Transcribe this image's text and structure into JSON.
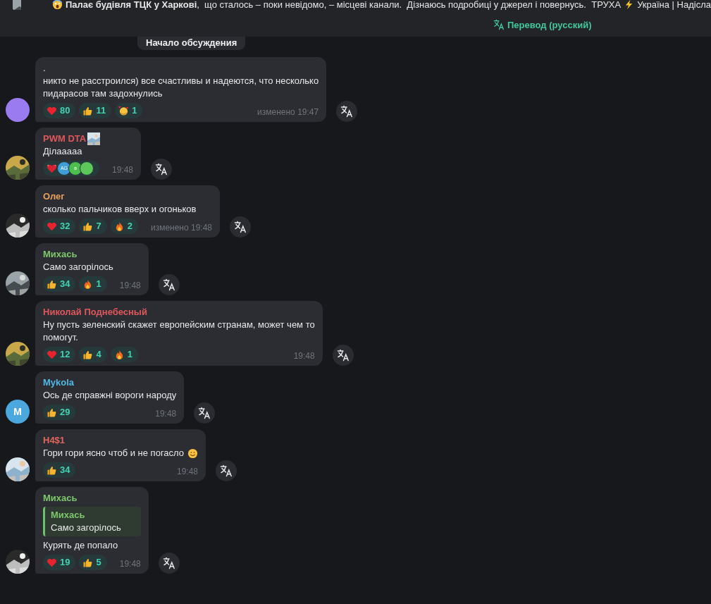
{
  "pinned": {
    "before": "**Палає будівля ТЦК у Харкові**,  що сталось – поки невідомо, – місцеві канали.  Дізнаюсь подробиці у джерел і повернусь.  ТРУХА",
    "after": "Україна | Надісла"
  },
  "translate_link": "Перевод (русский)",
  "discussion_start": "Начало обсуждения",
  "messages": [
    {
      "avatar": {
        "kind": "plain",
        "color": "#9b7cf0"
      },
      "lines": [
        ".",
        "никто не расстроился) все счастливы и надеются, что несколько",
        "пидарасов там задохнулись"
      ],
      "reactions": [
        {
          "kind": "heart",
          "count": "80"
        },
        {
          "kind": "thumbs",
          "count": "11"
        },
        {
          "kind": "hearts-face",
          "count": "1"
        }
      ],
      "time": "изменено 19:47"
    },
    {
      "avatar": {
        "kind": "picture"
      },
      "sender": "PWM DTA",
      "color": "#e0575b",
      "sender_badge": true,
      "lines": [
        "Ділааааа"
      ],
      "reactions": [
        {
          "kind": "sparkle-heart",
          "users": [
            {
              "initials": "AG",
              "color": "#3e9fd8"
            },
            {
              "initials": "в",
              "color": "#4cbf4c"
            },
            {
              "color": "#5cc85c"
            }
          ]
        }
      ],
      "time": "19:48"
    },
    {
      "avatar": {
        "kind": "picture"
      },
      "sender": "Олег",
      "color": "#e8a15a",
      "lines": [
        "сколько пальчиков вверх и огоньков"
      ],
      "reactions": [
        {
          "kind": "heart",
          "count": "32"
        },
        {
          "kind": "thumbs",
          "count": "7"
        },
        {
          "kind": "fire",
          "count": "2"
        }
      ],
      "time": "изменено 19:48"
    },
    {
      "avatar": {
        "kind": "picture"
      },
      "sender": "Михась",
      "color": "#7ec86b",
      "lines": [
        "Само загорілось"
      ],
      "reactions": [
        {
          "kind": "thumbs",
          "count": "34"
        },
        {
          "kind": "fire",
          "count": "1"
        }
      ],
      "time": "19:48"
    },
    {
      "avatar": {
        "kind": "picture"
      },
      "sender": "Николай Поднебесный",
      "color": "#e0575b",
      "lines": [
        "Ну пусть зеленский скажет европейским странам, может чем то",
        "помогут."
      ],
      "reactions": [
        {
          "kind": "heart",
          "count": "12"
        },
        {
          "kind": "thumbs",
          "count": "4"
        },
        {
          "kind": "fire",
          "count": "1"
        }
      ],
      "time": "19:48"
    },
    {
      "avatar": {
        "kind": "letter",
        "letter": "M",
        "color": "#4aa8df"
      },
      "sender": "Mykola",
      "color": "#52b8e6",
      "lines": [
        "Ось де справжні вороги народу"
      ],
      "reactions": [
        {
          "kind": "thumbs",
          "count": "29"
        }
      ],
      "time": "19:48"
    },
    {
      "avatar": {
        "kind": "picture"
      },
      "sender": "H4$1",
      "color": "#e0675b",
      "lines": [
        "Гори гори ясно чтоб и не погасло"
      ],
      "ends_with_smiley": true,
      "reactions": [
        {
          "kind": "thumbs",
          "count": "34"
        }
      ],
      "time": "19:48"
    },
    {
      "avatar": {
        "kind": "picture"
      },
      "sender": "Михась",
      "color": "#7ec86b",
      "reply": {
        "sender": "Михась",
        "text": "Само загорілось"
      },
      "lines": [
        "Курять де попало"
      ],
      "reactions": [
        {
          "kind": "heart",
          "count": "19"
        },
        {
          "kind": "thumbs",
          "count": "5"
        }
      ],
      "time": "19:48"
    }
  ]
}
